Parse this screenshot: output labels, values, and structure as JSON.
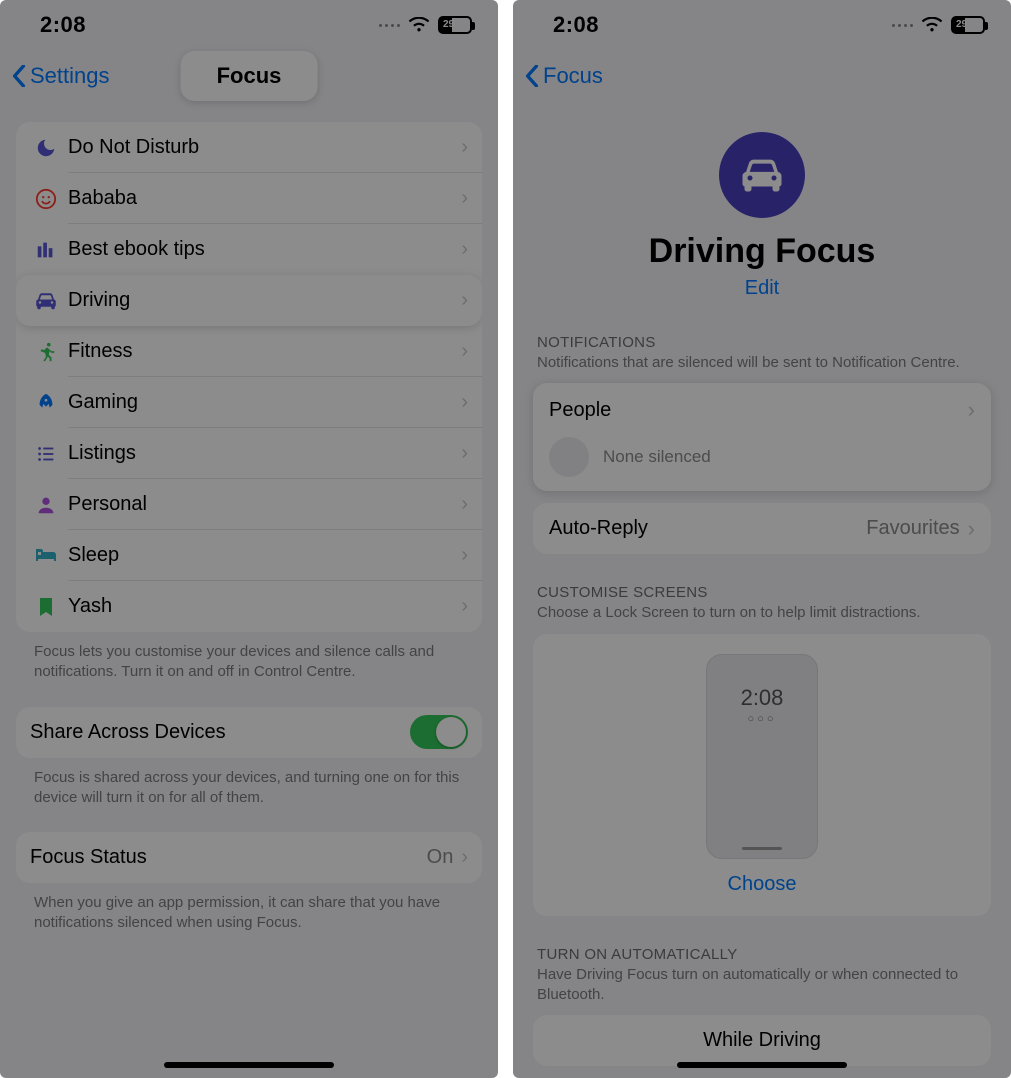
{
  "status": {
    "time": "2:08",
    "battery_level": "29"
  },
  "left": {
    "back_label": "Settings",
    "title": "Focus",
    "modes": [
      {
        "icon": "moon",
        "color": "#5856d6",
        "label": "Do Not Disturb"
      },
      {
        "icon": "smile",
        "color": "#ff3b30",
        "label": "Bababa"
      },
      {
        "icon": "books",
        "color": "#5856d6",
        "label": "Best ebook tips"
      },
      {
        "icon": "car",
        "color": "#5856d6",
        "label": "Driving",
        "highlight": true
      },
      {
        "icon": "runner",
        "color": "#34c759",
        "label": "Fitness"
      },
      {
        "icon": "rocket",
        "color": "#007aff",
        "label": "Gaming"
      },
      {
        "icon": "list",
        "color": "#5856d6",
        "label": "Listings"
      },
      {
        "icon": "person",
        "color": "#af52de",
        "label": "Personal"
      },
      {
        "icon": "bed",
        "color": "#30b0c7",
        "label": "Sleep"
      },
      {
        "icon": "bookmark",
        "color": "#34c759",
        "label": "Yash"
      }
    ],
    "footnote1": "Focus lets you customise your devices and silence calls and notifications. Turn it on and off in Control Centre.",
    "share_label": "Share Across Devices",
    "share_on": true,
    "footnote2": "Focus is shared across your devices, and turning one on for this device will turn it on for all of them.",
    "status_label": "Focus Status",
    "status_value": "On",
    "footnote3": "When you give an app permission, it can share that you have notifications silenced when using Focus."
  },
  "right": {
    "back_label": "Focus",
    "title": "Driving Focus",
    "edit": "Edit",
    "sections": {
      "notifications": {
        "header": "NOTIFICATIONS",
        "sub": "Notifications that are silenced will be sent to Notification Centre.",
        "people_label": "People",
        "people_status": "None silenced",
        "auto_reply_label": "Auto-Reply",
        "auto_reply_value": "Favourites"
      },
      "screens": {
        "header": "CUSTOMISE SCREENS",
        "sub": "Choose a Lock Screen to turn on to help limit distractions.",
        "lock_time": "2:08",
        "choose": "Choose"
      },
      "auto": {
        "header": "TURN ON AUTOMATICALLY",
        "sub": "Have Driving Focus turn on automatically or when connected to Bluetooth.",
        "row_label": "While Driving"
      }
    }
  }
}
